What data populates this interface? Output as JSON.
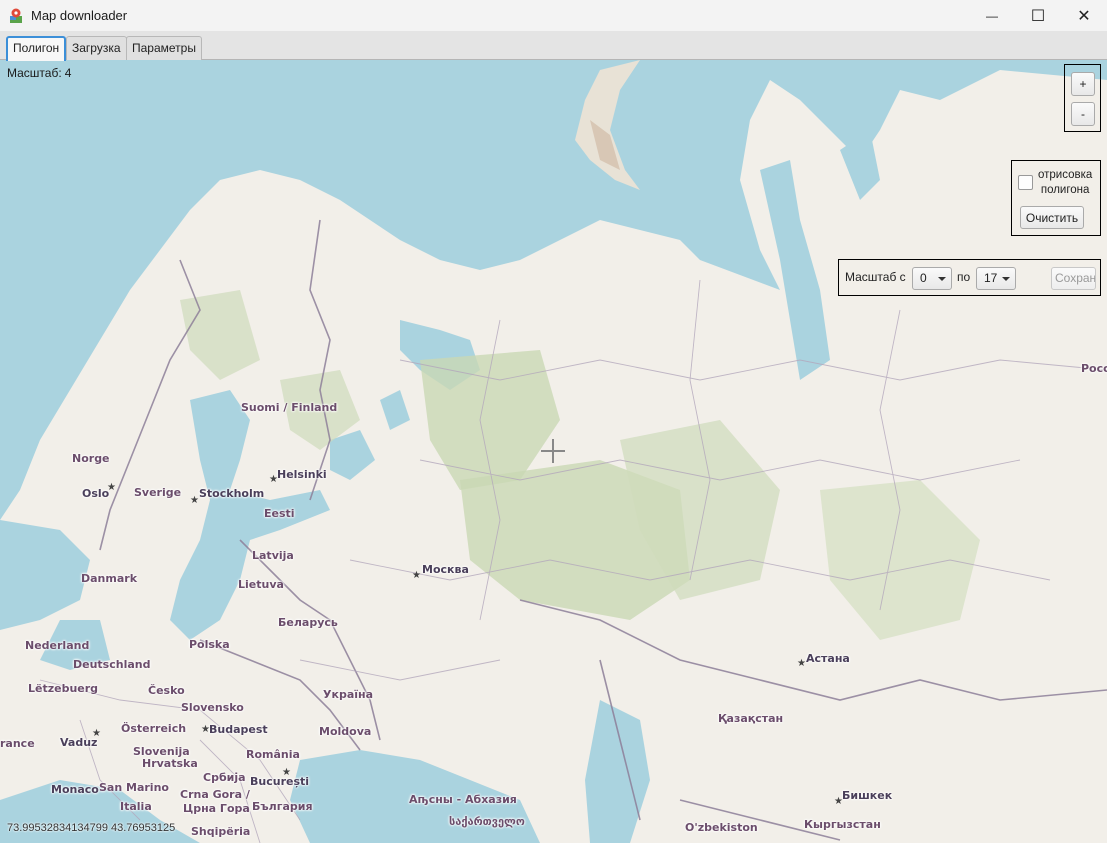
{
  "window": {
    "title": "Map downloader",
    "controls": {
      "minimize": "—",
      "maximize": "☐",
      "close": "✕"
    }
  },
  "tabs": [
    {
      "label": "Полигон",
      "active": true
    },
    {
      "label": "Загрузка",
      "active": false
    },
    {
      "label": "Параметры",
      "active": false
    }
  ],
  "map": {
    "zoom_label": "Масштаб:",
    "zoom_value": "4",
    "coordinates": "73.99532834134799 43.76953125",
    "places": [
      {
        "key": "suomi",
        "text": "Suomi / Finland",
        "kind": "country"
      },
      {
        "key": "norge",
        "text": "Norge",
        "kind": "country"
      },
      {
        "key": "oslo",
        "text": "Oslo",
        "kind": "city"
      },
      {
        "key": "sverige",
        "text": "Sverige",
        "kind": "country"
      },
      {
        "key": "stockholm",
        "text": "Stockholm",
        "kind": "city"
      },
      {
        "key": "helsinki",
        "text": "Helsinki",
        "kind": "city"
      },
      {
        "key": "eesti",
        "text": "Eesti",
        "kind": "country"
      },
      {
        "key": "latvija",
        "text": "Latvija",
        "kind": "country"
      },
      {
        "key": "danmark",
        "text": "Danmark",
        "kind": "country"
      },
      {
        "key": "lietuva",
        "text": "Lietuva",
        "kind": "country"
      },
      {
        "key": "moskva",
        "text": "Москва",
        "kind": "city"
      },
      {
        "key": "belarus",
        "text": "Беларусь",
        "kind": "country"
      },
      {
        "key": "nederland",
        "text": "Nederland",
        "kind": "country"
      },
      {
        "key": "deutschland",
        "text": "Deutschland",
        "kind": "country"
      },
      {
        "key": "polska",
        "text": "Polska",
        "kind": "country"
      },
      {
        "key": "letzebuerg",
        "text": "Lëtzebuerg",
        "kind": "country"
      },
      {
        "key": "cesko",
        "text": "Česko",
        "kind": "country"
      },
      {
        "key": "ukraina",
        "text": "Україна",
        "kind": "country"
      },
      {
        "key": "slovensko",
        "text": "Slovensko",
        "kind": "country"
      },
      {
        "key": "osterreich",
        "text": "Österreich",
        "kind": "country"
      },
      {
        "key": "budapest",
        "text": "Budapest",
        "kind": "city"
      },
      {
        "key": "france",
        "text": "rance",
        "kind": "country"
      },
      {
        "key": "vaduz",
        "text": "Vaduz",
        "kind": "city"
      },
      {
        "key": "slovenija",
        "text": "Slovenija",
        "kind": "country"
      },
      {
        "key": "moldova",
        "text": "Moldova",
        "kind": "country"
      },
      {
        "key": "hrvatska",
        "text": "Hrvatska",
        "kind": "country"
      },
      {
        "key": "romania",
        "text": "România",
        "kind": "country"
      },
      {
        "key": "monaco",
        "text": "Monaco",
        "kind": "city"
      },
      {
        "key": "sanmarino",
        "text": "San Marino",
        "kind": "country"
      },
      {
        "key": "srbija",
        "text": "Србија",
        "kind": "country"
      },
      {
        "key": "bucuresti",
        "text": "București",
        "kind": "city"
      },
      {
        "key": "crnagora",
        "text": "Crna Gora /",
        "kind": "country"
      },
      {
        "key": "crnagora2",
        "text": "Црна Гора",
        "kind": "country"
      },
      {
        "key": "italia",
        "text": "Italia",
        "kind": "country"
      },
      {
        "key": "bulgaria",
        "text": "България",
        "kind": "country"
      },
      {
        "key": "shqiperia",
        "text": "Shqipëria",
        "kind": "country"
      },
      {
        "key": "abkhazia",
        "text": "Аҧсны - Абхазия",
        "kind": "country"
      },
      {
        "key": "georgia",
        "text": "საქართველო",
        "kind": "country"
      },
      {
        "key": "astana",
        "text": "Астана",
        "kind": "city"
      },
      {
        "key": "kazakhstan",
        "text": "Қазақстан",
        "kind": "country"
      },
      {
        "key": "bishkek",
        "text": "Бишкек",
        "kind": "city"
      },
      {
        "key": "uzbekiston",
        "text": "O'zbekiston",
        "kind": "country"
      },
      {
        "key": "kyrgyzstan",
        "text": "Кыргызстан",
        "kind": "country"
      },
      {
        "key": "rossiya",
        "text": "Росс",
        "kind": "country"
      }
    ]
  },
  "controls": {
    "zoom_in": "+",
    "zoom_out": "-",
    "polygon_draw_label_1": "отрисовка",
    "polygon_draw_label_2": "полигона",
    "polygon_draw_checked": false,
    "clear_button": "Очистить",
    "scale_from_label": "Масштаб с",
    "scale_from_value": "0",
    "scale_to_label": "по",
    "scale_to_value": "17",
    "save_button": "Сохранить",
    "save_enabled": false
  },
  "colors": {
    "water": "#aad3df",
    "land": "#f2efe9",
    "forest": "#add19e",
    "border": "#8d7f99",
    "tab_active_border": "#3c8fd8"
  }
}
